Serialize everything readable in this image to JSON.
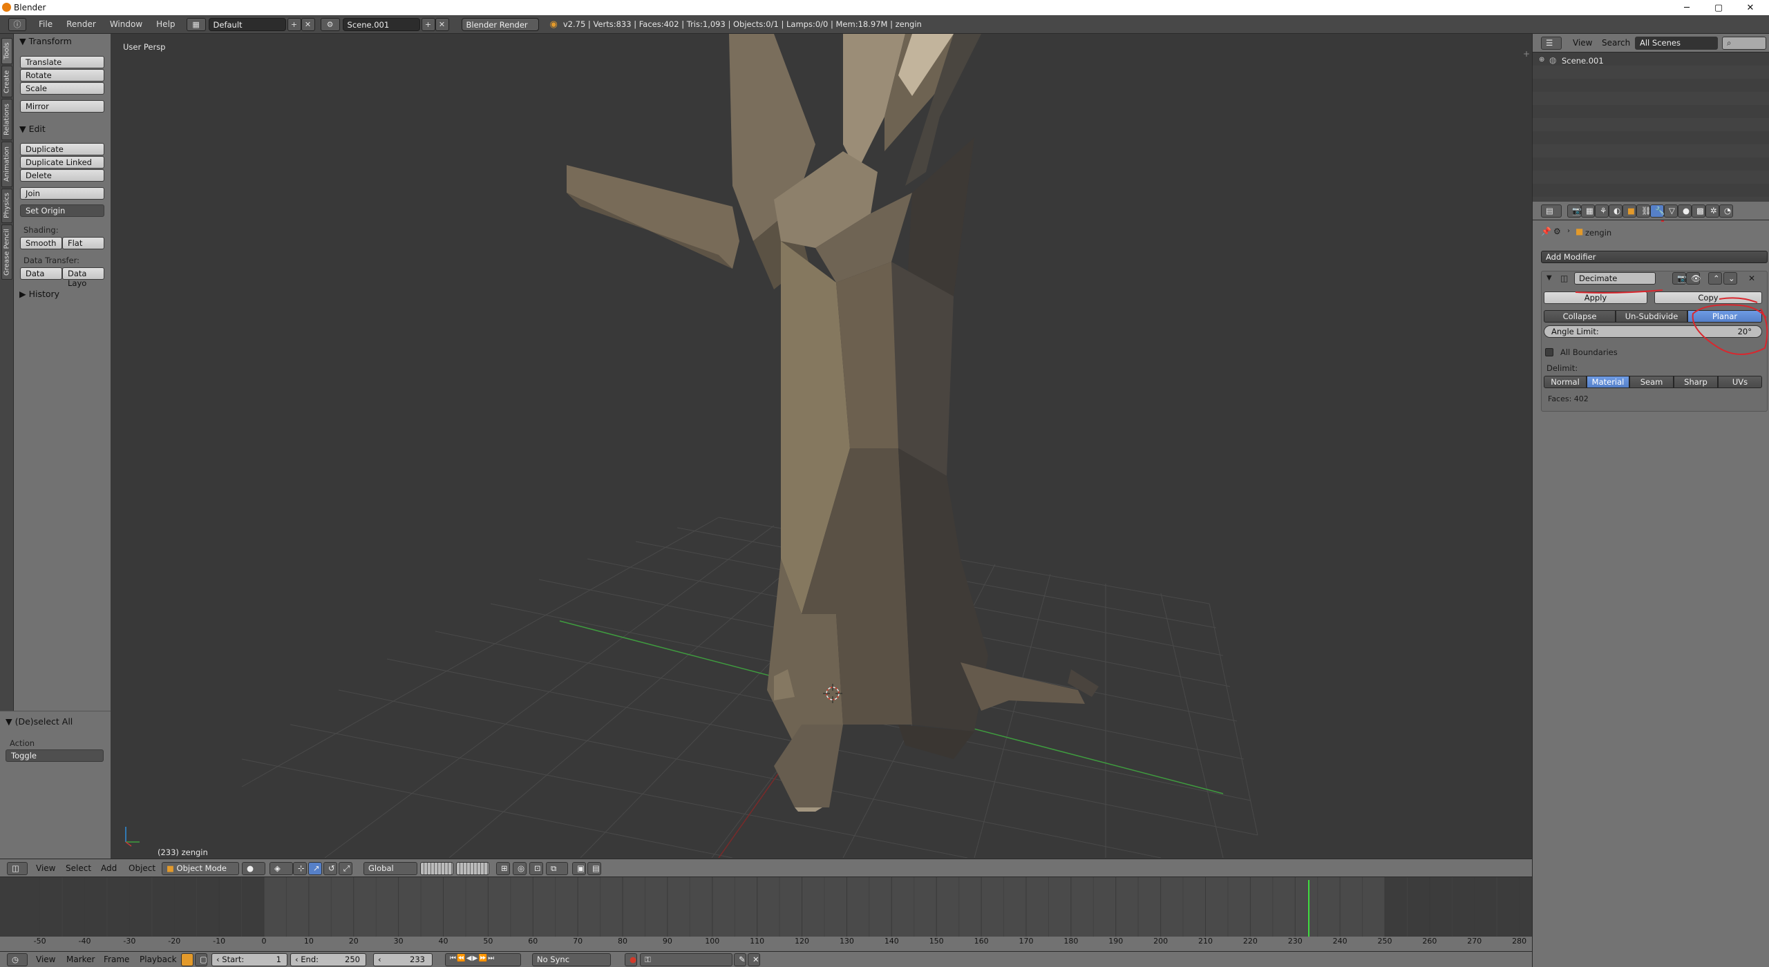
{
  "window": {
    "title": "Blender",
    "minimize": "─",
    "maximize": "▢",
    "close": "✕"
  },
  "infobar": {
    "menus": [
      "File",
      "Render",
      "Window",
      "Help"
    ],
    "screen_layout": "Default",
    "scene": "Scene.001",
    "render_engine": "Blender Render",
    "stats": "v2.75 | Verts:833 | Faces:402 | Tris:1,093 | Objects:0/1 | Lamps:0/0 | Mem:18.97M | zengin"
  },
  "tool_tabs": [
    "Tools",
    "Create",
    "Relations",
    "Animation",
    "Physics",
    "Grease Pencil"
  ],
  "tool_shelf": {
    "transform_header": "Transform",
    "translate": "Translate",
    "rotate": "Rotate",
    "scale": "Scale",
    "mirror": "Mirror",
    "edit_header": "Edit",
    "duplicate": "Duplicate",
    "duplicate_linked": "Duplicate Linked",
    "delete": "Delete",
    "join": "Join",
    "set_origin": "Set Origin",
    "shading_label": "Shading:",
    "smooth": "Smooth",
    "flat": "Flat",
    "data_transfer_label": "Data Transfer:",
    "data": "Data",
    "data_layo": "Data Layo",
    "history_header": "History"
  },
  "operator_panel": {
    "header": "(De)select All",
    "action_label": "Action",
    "action_value": "Toggle"
  },
  "viewport": {
    "view_name": "User Persp",
    "object_label": "(233) zengin"
  },
  "viewport_header": {
    "menus": [
      "View",
      "Select",
      "Add",
      "Object"
    ],
    "mode": "Object Mode",
    "orientation": "Global"
  },
  "timeline": {
    "ticks": [
      "-50",
      "-40",
      "-30",
      "-20",
      "-10",
      "0",
      "10",
      "20",
      "30",
      "40",
      "50",
      "60",
      "70",
      "80",
      "90",
      "100",
      "110",
      "120",
      "130",
      "140",
      "150",
      "160",
      "170",
      "180",
      "190",
      "200",
      "210",
      "220",
      "230",
      "240",
      "250",
      "260",
      "270",
      "280"
    ],
    "current_frame": 233,
    "menus": [
      "View",
      "Marker",
      "Frame",
      "Playback"
    ],
    "start_label": "Start:",
    "start_value": "1",
    "end_label": "End:",
    "end_value": "250",
    "frame_value": "233",
    "sync": "No Sync"
  },
  "outliner": {
    "menus": [
      "View",
      "Search"
    ],
    "scenes_dropdown": "All Scenes",
    "scene_item": "Scene.001"
  },
  "properties": {
    "object_name": "zengin",
    "add_modifier": "Add Modifier",
    "modifier_name": "Decimate",
    "apply": "Apply",
    "copy": "Copy",
    "modes": [
      "Collapse",
      "Un-Subdivide",
      "Planar"
    ],
    "active_mode": "Planar",
    "angle_limit_label": "Angle Limit:",
    "angle_limit_value": "20°",
    "all_boundaries": "All Boundaries",
    "delimit_label": "Delimit:",
    "delimit": [
      "Normal",
      "Material",
      "Seam",
      "Sharp",
      "UVs"
    ],
    "delimit_active": "Material",
    "faces": "Faces: 402"
  },
  "colors": {
    "accent": "#5680c8",
    "annotation": "#d9272e",
    "x_axis": "#9a2c2c",
    "y_axis": "#3f9c3f",
    "frame_cursor": "#3fdc3f"
  }
}
